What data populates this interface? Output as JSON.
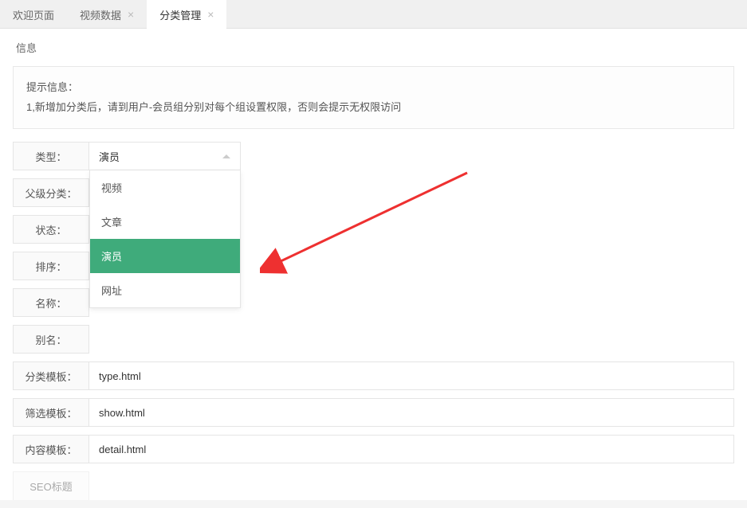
{
  "tabs": [
    {
      "label": "欢迎页面",
      "closable": false
    },
    {
      "label": "视频数据",
      "closable": true
    },
    {
      "label": "分类管理",
      "closable": true,
      "active": true
    }
  ],
  "section_title": "信息",
  "hint": {
    "title": "提示信息：",
    "line1": "1,新增加分类后，请到用户-会员组分别对每个组设置权限，否则会提示无权限访问"
  },
  "form": {
    "type": {
      "label": "类型：",
      "value": "演员",
      "options": [
        "视频",
        "文章",
        "演员",
        "网址"
      ]
    },
    "parent": {
      "label": "父级分类："
    },
    "status": {
      "label": "状态："
    },
    "sort": {
      "label": "排序："
    },
    "name": {
      "label": "名称："
    },
    "alias": {
      "label": "别名："
    },
    "type_tpl": {
      "label": "分类模板：",
      "value": "type.html"
    },
    "filter_tpl": {
      "label": "筛选模板：",
      "value": "show.html"
    },
    "content_tpl": {
      "label": "内容模板：",
      "value": "detail.html"
    },
    "seo_title": {
      "label": "SEO标题"
    }
  }
}
